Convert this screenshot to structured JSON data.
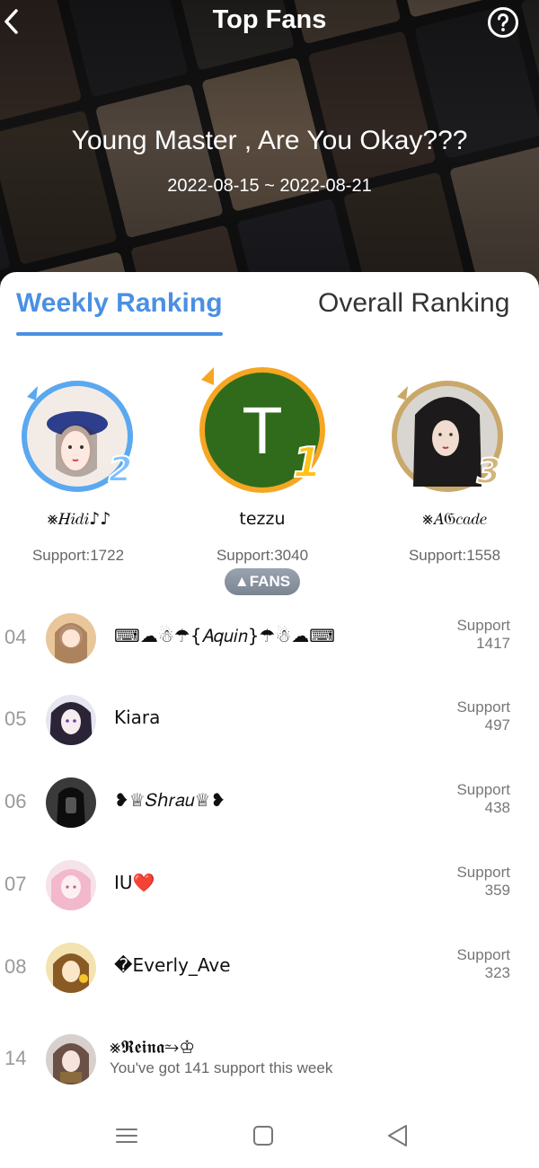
{
  "header": {
    "title": "Top Fans",
    "book_title": "Young Master , Are You Okay???",
    "date_range": "2022-08-15 ~ 2022-08-21"
  },
  "tabs": [
    {
      "label": "Weekly Ranking",
      "active": true
    },
    {
      "label": "Overall Ranking",
      "active": false
    }
  ],
  "podium": {
    "first": {
      "rank": "1",
      "name": "tezzu",
      "support": "Support:3040",
      "avatar_letter": "T"
    },
    "second": {
      "rank": "2",
      "name": "⨳𝐻𝑖𝑑𝑖♪♪",
      "support": "Support:1722"
    },
    "third": {
      "rank": "3",
      "name": "⨳𝐴𝔊𝑐𝑎𝑑𝑒",
      "support": "Support:1558"
    }
  },
  "fans_badge": "FANS",
  "ranking": [
    {
      "rank": "04",
      "name": "⌨☁☃☂{𝐴𝑞𝑢𝑖𝑛}☂☃☁⌨",
      "support_label": "Support",
      "support_value": "1417"
    },
    {
      "rank": "05",
      "name": "Kiara",
      "support_label": "Support",
      "support_value": "497"
    },
    {
      "rank": "06",
      "name": "❥♕𝑆ℎ𝑟𝑎𝑢♕❥",
      "support_label": "Support",
      "support_value": "438"
    },
    {
      "rank": "07",
      "name": "IU❤️",
      "support_label": "Support",
      "support_value": "359"
    },
    {
      "rank": "08",
      "name": "�Everly_Ave",
      "support_label": "Support",
      "support_value": "323"
    }
  ],
  "my_rank": {
    "rank": "14",
    "name": "⨳𝕽𝖊𝖎𝖓𝖆⥲♔",
    "message": "You've got 141 support this week"
  },
  "colors": {
    "accent": "#4a90e2",
    "gold": "#f5a623",
    "silver_blue": "#5aa8f0",
    "bronze": "#c9a86a",
    "first_avatar_bg": "#2f6b1a"
  },
  "icons": {
    "back": "chevron-left-icon",
    "help": "question-circle-icon",
    "nav_menu": "menu-icon",
    "nav_home": "square-icon",
    "nav_back": "triangle-back-icon"
  }
}
